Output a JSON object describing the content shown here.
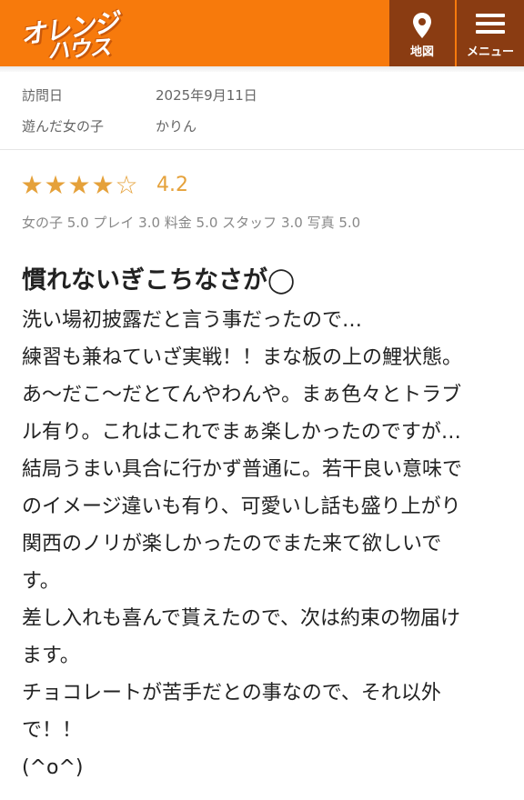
{
  "header": {
    "logo_line1": "オレンジ",
    "logo_line2": "ハウス",
    "map_label": "地図",
    "menu_label": "メニュー",
    "icons": {
      "map": "map-pin-icon",
      "menu": "hamburger-menu-icon"
    },
    "colors": {
      "bar": "#f77a0c",
      "buttons": "#8a3c12"
    }
  },
  "info": {
    "visit_date_label": "訪問日",
    "visit_date_value": "2025年9月11日",
    "girl_label": "遊んだ女の子",
    "girl_value": "かりん"
  },
  "rating": {
    "stars": 4,
    "max_stars": 5,
    "score": "4.2",
    "star_color": "#e5a13a",
    "sub_scores": "女の子 5.0 プレイ 3.0 料金 5.0 スタッフ 3.0 写真 5.0"
  },
  "review": {
    "title": "慣れないぎこちなさが◯",
    "lines": [
      "洗い場初披露だと言う事だったので…",
      "練習も兼ねていざ実戦！！まな板の上の鯉状態。",
      "あ〜だこ〜だとてんやわんや。まぁ色々とトラブ",
      "ル有り。これはこれでまぁ楽しかったのですが…",
      "結局うまい具合に行かず普通に。若干良い意味で",
      "のイメージ違いも有り、可愛いし話も盛り上がり",
      "関西のノリが楽しかったのでまた来て欲しいで",
      "す。",
      "差し入れも喜んで貰えたので、次は約束の物届け",
      "ます。",
      "チョコレートが苦手だとの事なので、それ以外",
      "で！！",
      "(^o^)"
    ]
  }
}
